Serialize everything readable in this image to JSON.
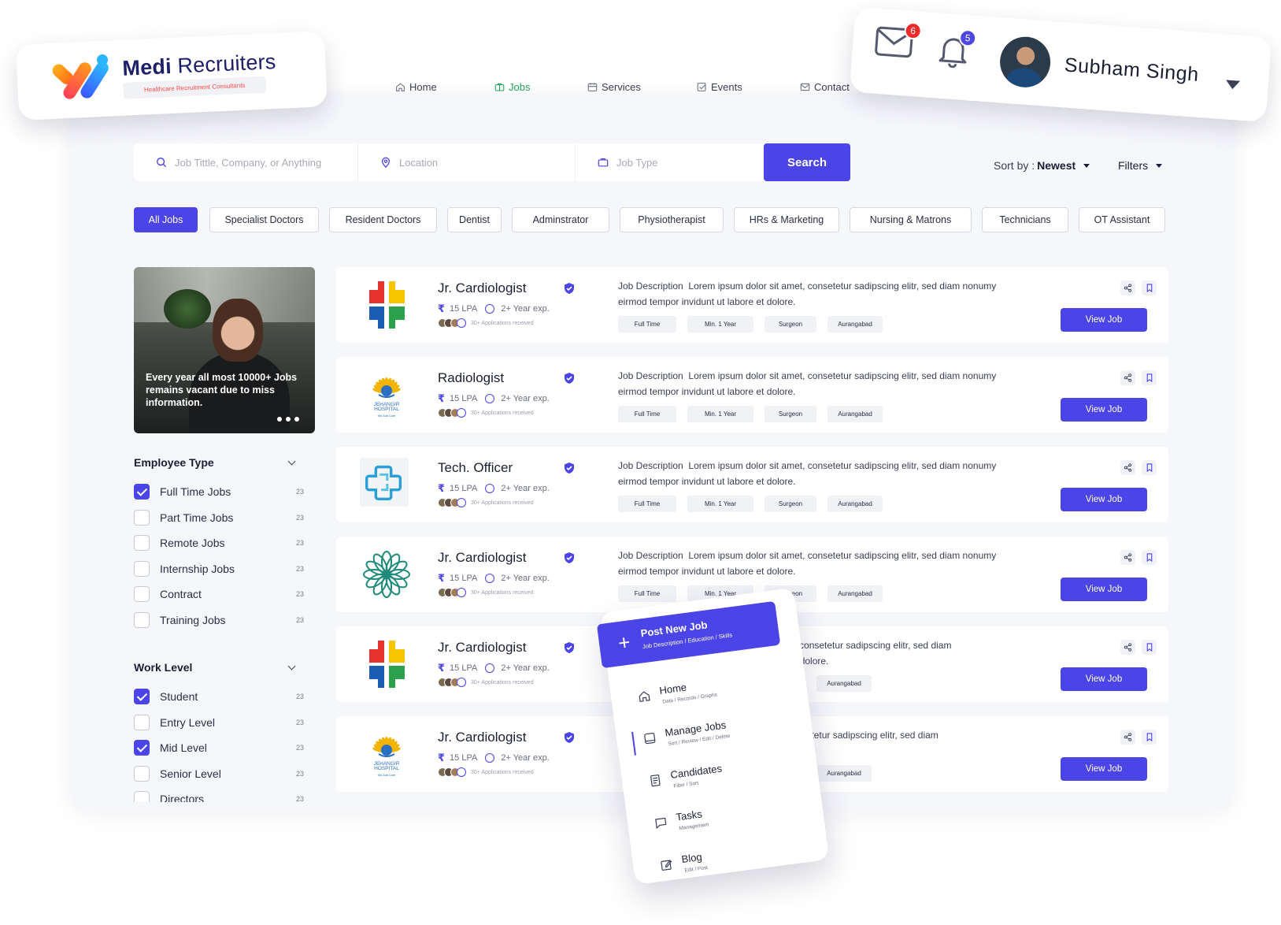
{
  "brand": {
    "name_bold": "Medi",
    "name_rest": " Recruiters",
    "tagline": "Healthcare Recruitment Consultants"
  },
  "nav": [
    {
      "label": "Home",
      "icon": "home-icon",
      "active": false
    },
    {
      "label": "Jobs",
      "icon": "briefcase-icon",
      "active": true
    },
    {
      "label": "Services",
      "icon": "calendar-icon",
      "active": false
    },
    {
      "label": "Events",
      "icon": "check-square-icon",
      "active": false
    },
    {
      "label": "Contact",
      "icon": "mail-icon",
      "active": false
    }
  ],
  "user": {
    "name": "Subham Singh",
    "mail_count": "6",
    "notification_count": "5"
  },
  "search": {
    "keyword_placeholder": "Job Tittle, Company, or Anything",
    "location_placeholder": "Location",
    "jobtype_placeholder": "Job Type",
    "button": "Search"
  },
  "sort": {
    "label": "Sort by :",
    "value": "Newest"
  },
  "filters_label": "Filters",
  "categories": [
    "All Jobs",
    "Specialist Doctors",
    "Resident Doctors",
    "Dentist",
    "Adminstrator",
    "Physiotherapist",
    "HRs & Marketing",
    "Nursing & Matrons",
    "Technicians",
    "OT Assistant"
  ],
  "promo": {
    "text": "Every year all most 10000+ Jobs remains vacant due to miss information."
  },
  "employee_type": {
    "title": "Employee Type",
    "items": [
      {
        "label": "Full Time Jobs",
        "count": "23",
        "checked": true
      },
      {
        "label": "Part Time Jobs",
        "count": "23",
        "checked": false
      },
      {
        "label": "Remote Jobs",
        "count": "23",
        "checked": false
      },
      {
        "label": "Internship Jobs",
        "count": "23",
        "checked": false
      },
      {
        "label": "Contract",
        "count": "23",
        "checked": false
      },
      {
        "label": "Training Jobs",
        "count": "23",
        "checked": false
      }
    ]
  },
  "work_level": {
    "title": "Work Level",
    "items": [
      {
        "label": "Student",
        "count": "23",
        "checked": true
      },
      {
        "label": "Entry Level",
        "count": "23",
        "checked": false
      },
      {
        "label": "Mid Level",
        "count": "23",
        "checked": true
      },
      {
        "label": "Senior Level",
        "count": "23",
        "checked": false
      },
      {
        "label": "Directors",
        "count": "23",
        "checked": false
      }
    ]
  },
  "jobs": [
    {
      "title": "Jr. Cardiologist",
      "logo": "cross-logo",
      "salary": "15 LPA",
      "experience": "2+ Year exp.",
      "applications": "30+ Applications received",
      "desc_label": "Job Description",
      "desc": "Lorem ipsum dolor sit amet, consetetur sadipscing elitr, sed diam nonumy eirmod tempor invidunt ut labore et dolore.",
      "tags": [
        "Full Time",
        "Min. 1 Year",
        "Surgeon",
        "Aurangabad"
      ],
      "button": "View Job"
    },
    {
      "title": "Radiologist",
      "logo": "jehangir-logo",
      "salary": "15 LPA",
      "experience": "2+ Year exp.",
      "applications": "30+ Applications received",
      "desc_label": "Job Description",
      "desc": "Lorem ipsum dolor sit amet, consetetur sadipscing elitr, sed diam nonumy eirmod tempor invidunt ut labore et dolore.",
      "tags": [
        "Full Time",
        "Min. 1 Year",
        "Surgeon",
        "Aurangabad"
      ],
      "button": "View Job"
    },
    {
      "title": "Tech. Officer",
      "logo": "medical-cross-logo",
      "salary": "15 LPA",
      "experience": "2+ Year exp.",
      "applications": "30+ Applications received",
      "desc_label": "Job Description",
      "desc": "Lorem ipsum dolor sit amet, consetetur sadipscing elitr, sed diam nonumy eirmod tempor invidunt ut labore et dolore.",
      "tags": [
        "Full Time",
        "Min. 1 Year",
        "Surgeon",
        "Aurangabad"
      ],
      "button": "View Job"
    },
    {
      "title": "Jr. Cardiologist",
      "logo": "mandala-logo",
      "salary": "15 LPA",
      "experience": "2+ Year exp.",
      "applications": "30+ Applications received",
      "desc_label": "Job Description",
      "desc": "Lorem ipsum dolor sit amet, consetetur sadipscing elitr, sed diam nonumy eirmod tempor invidunt ut labore et dolore.",
      "tags": [
        "Full Time",
        "Min. 1 Year",
        "Surgeon",
        "Aurangabad"
      ],
      "button": "View Job"
    },
    {
      "title": "Jr. Cardiologist",
      "logo": "cross-logo",
      "salary": "15 LPA",
      "experience": "2+ Year exp.",
      "applications": "30+ Applications received",
      "desc_label": "",
      "desc": "t amet, consetetur sadipscing elitr, sed diam\nbore et dolore.",
      "tags": [
        "Aurangabad"
      ],
      "button": "View Job"
    },
    {
      "title": "Jr. Cardiologist",
      "logo": "jehangir-logo",
      "salary": "15 LPA",
      "experience": "2+ Year exp.",
      "applications": "30+ Applications received",
      "desc_label": "",
      "desc": "net, consetetur sadipscing elitr, sed diam\ne et dolore.",
      "tags": [
        "Aurangabad"
      ],
      "button": "View Job"
    }
  ],
  "jehangir_logo": {
    "line1": "JEHANGIR",
    "line2": "HOSPITAL",
    "line3": "We Add Care"
  },
  "menu": {
    "post_title": "Post New Job",
    "post_sub": "Job Description / Education / Skills",
    "items": [
      {
        "label": "Home",
        "sub": "Data / Records / Graphs",
        "icon": "home-icon"
      },
      {
        "label": "Manage Jobs",
        "sub": "Sort / Review / Edit / Delete",
        "icon": "briefcase-icon"
      },
      {
        "label": "Candidates",
        "sub": "Filter / Sort",
        "icon": "document-icon"
      },
      {
        "label": "Tasks",
        "sub": "Management",
        "icon": "chat-icon"
      },
      {
        "label": "Blog",
        "sub": "Edit / Post",
        "icon": "edit-icon"
      }
    ]
  },
  "colors": {
    "accent": "#4b44e6",
    "active_nav": "#21a35a",
    "badge_red": "#ef2a2a"
  }
}
